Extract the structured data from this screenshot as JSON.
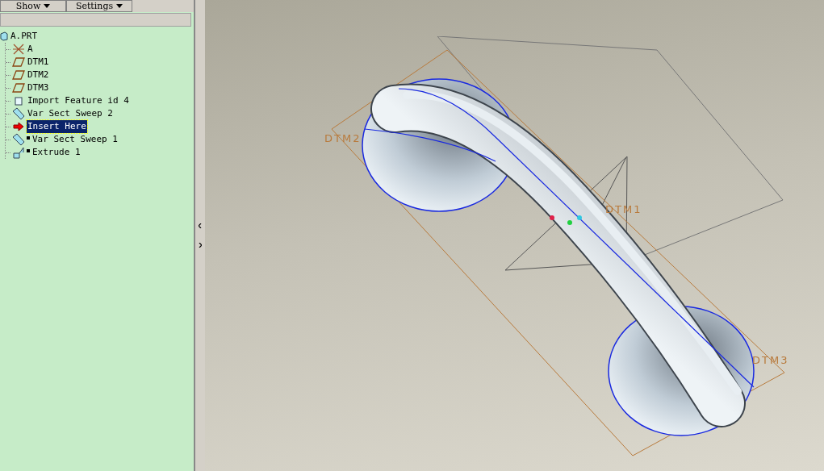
{
  "toolbar": {
    "buttons": [
      {
        "label": "Show"
      },
      {
        "label": "Settings"
      }
    ]
  },
  "tree": {
    "label": "A.PRT",
    "kind": "part",
    "children": [
      {
        "label": "A",
        "kind": "axis",
        "selected": false,
        "flagged": false
      },
      {
        "label": "DTM1",
        "kind": "plane",
        "selected": false,
        "flagged": false
      },
      {
        "label": "DTM2",
        "kind": "plane",
        "selected": false,
        "flagged": false
      },
      {
        "label": "DTM3",
        "kind": "plane",
        "selected": false,
        "flagged": false
      },
      {
        "label": "Import Feature id 4",
        "kind": "import",
        "selected": false,
        "flagged": false
      },
      {
        "label": "Var Sect Sweep 2",
        "kind": "sweep",
        "selected": false,
        "flagged": false
      },
      {
        "label": "Insert Here",
        "kind": "insert",
        "selected": true,
        "flagged": false
      },
      {
        "label": "Var Sect Sweep 1",
        "kind": "sweep",
        "selected": false,
        "flagged": true
      },
      {
        "label": "Extrude 1",
        "kind": "extrude",
        "selected": false,
        "flagged": true
      }
    ]
  },
  "viewport": {
    "labels": [
      {
        "text": "DTM2"
      },
      {
        "text": "DTM1"
      },
      {
        "text": "DTM3"
      }
    ]
  }
}
